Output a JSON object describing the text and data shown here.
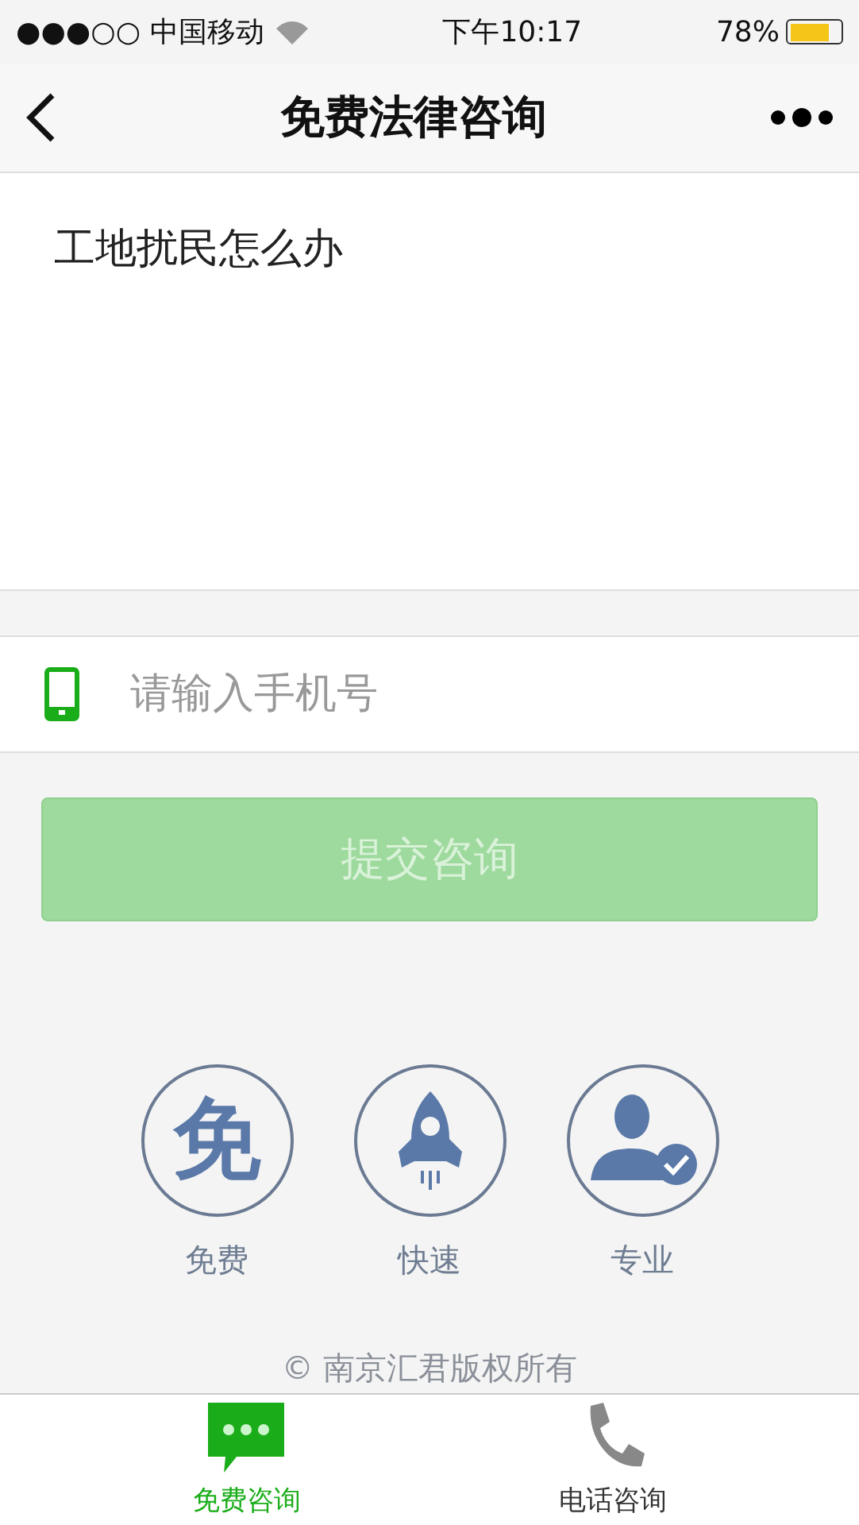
{
  "status_bar": {
    "carrier": "●●●○○ 中国移动",
    "time": "下午10:17",
    "battery_text": "78%"
  },
  "nav": {
    "title": "免费法律咨询"
  },
  "question": {
    "value": "工地扰民怎么办"
  },
  "phone_field": {
    "placeholder": "请输入手机号"
  },
  "submit": {
    "label": "提交咨询",
    "disabled": true
  },
  "features": [
    {
      "kind": "free",
      "label": "免费",
      "glyph": "免"
    },
    {
      "kind": "fast",
      "label": "快速"
    },
    {
      "kind": "pro",
      "label": "专业"
    }
  ],
  "footer": {
    "text": "© 南京汇君版权所有"
  },
  "tabs": [
    {
      "kind": "chat",
      "label": "免费咨询",
      "selected": true
    },
    {
      "kind": "phone",
      "label": "电话咨询",
      "selected": false
    }
  ]
}
